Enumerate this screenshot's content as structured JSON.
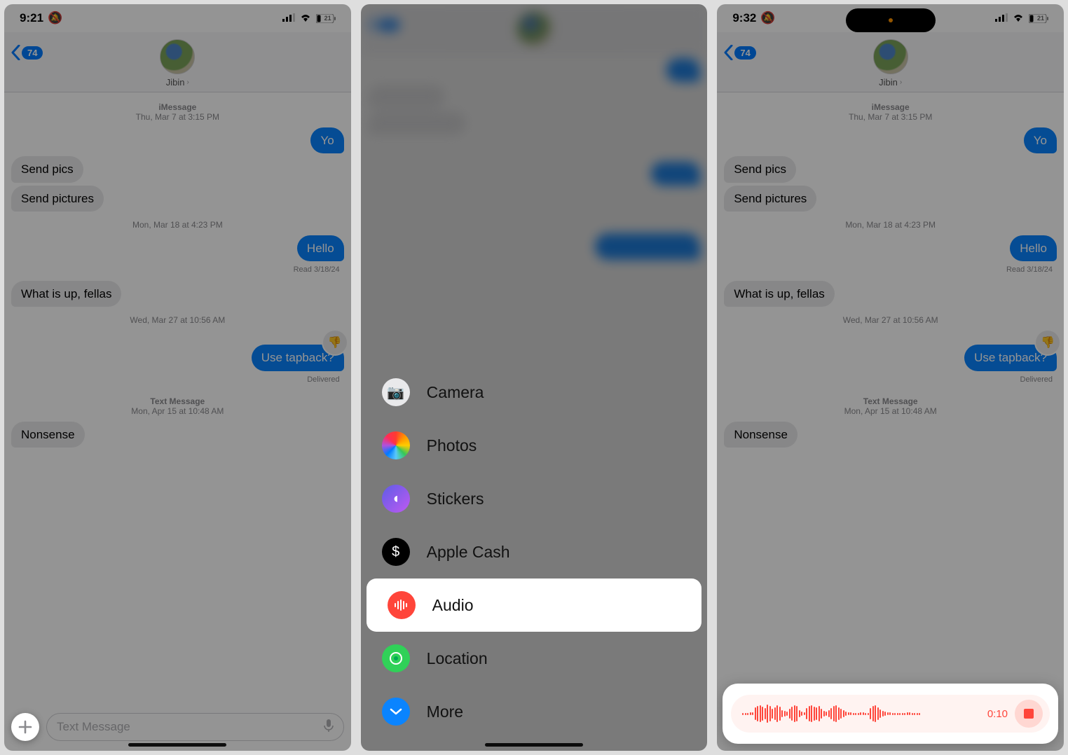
{
  "status": {
    "time1": "9:21",
    "time3": "9:32",
    "batt": "21"
  },
  "nav": {
    "badge": "74",
    "name": "Jibin"
  },
  "thread": {
    "ts1a": "iMessage",
    "ts1b": "Thu, Mar 7 at 3:15 PM",
    "m1": "Yo",
    "m2": "Send pics",
    "m3": "Send pictures",
    "ts2": "Mon, Mar 18 at 4:23 PM",
    "m4": "Hello",
    "read": "Read 3/18/24",
    "m5": "What is up, fellas",
    "ts3": "Wed, Mar 27 at 10:56 AM",
    "m6": "Use tapback?",
    "delivered": "Delivered",
    "ts4a": "Text Message",
    "ts4b": "Mon, Apr 15 at 10:48 AM",
    "m7": "Nonsense"
  },
  "input": {
    "placeholder": "Text Message"
  },
  "menu": {
    "camera": "Camera",
    "photos": "Photos",
    "stickers": "Stickers",
    "cash": "Apple Cash",
    "audio": "Audio",
    "location": "Location",
    "more": "More"
  },
  "rec": {
    "time": "0:10"
  }
}
